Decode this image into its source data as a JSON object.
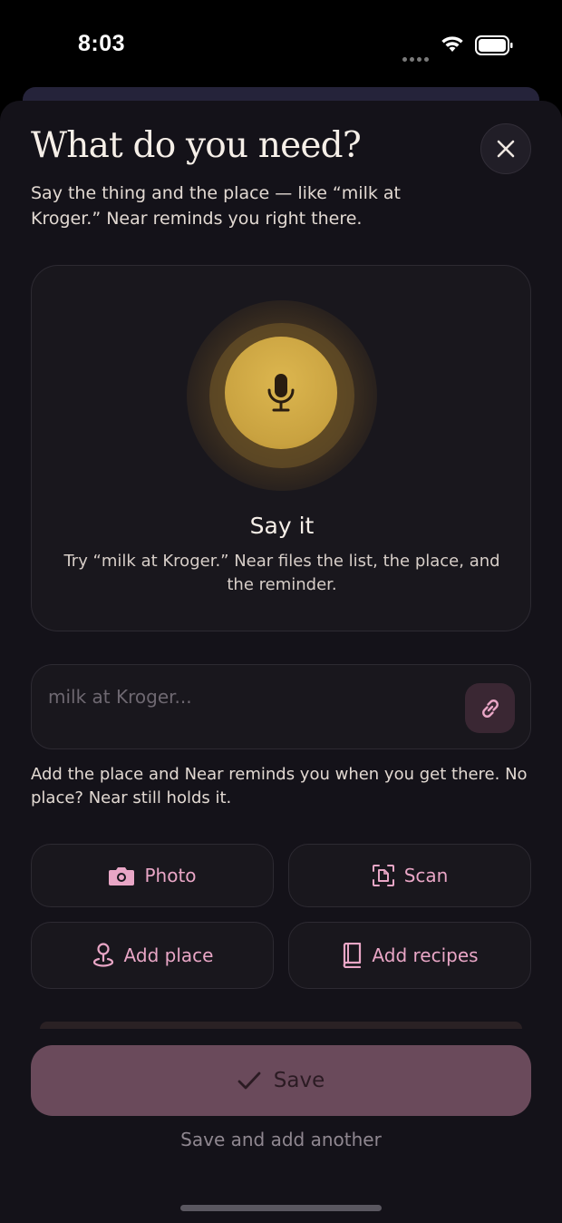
{
  "status_bar": {
    "time": "8:03"
  },
  "sheet": {
    "title": "What do you need?",
    "subtitle": "Say the thing and the place — like “milk at Kroger.” Near reminds you right there."
  },
  "voice": {
    "title": "Say it",
    "hint": "Try “milk at Kroger.” Near files the list, the place, and the reminder."
  },
  "input": {
    "placeholder": "milk at Kroger...",
    "value": ""
  },
  "helper_text": "Add the place and Near reminds you when you get there. No place? Near still holds it.",
  "actions": {
    "photo": "Photo",
    "scan": "Scan",
    "add_place": "Add place",
    "add_recipes": "Add recipes"
  },
  "footer": {
    "save_label": "Save",
    "save_another_label": "Save and add another"
  },
  "colors": {
    "accent_pink": "#e9a6c6",
    "mic_gold": "#d4ae48",
    "save_button": "#6a4a5b",
    "sheet_background": "#141219"
  },
  "icons": {
    "close": "close-icon",
    "mic": "microphone-icon",
    "link": "link-icon",
    "photo": "camera-icon",
    "scan": "scan-document-icon",
    "add_place": "map-pin-icon",
    "add_recipes": "book-icon",
    "save": "checkmark-icon"
  }
}
